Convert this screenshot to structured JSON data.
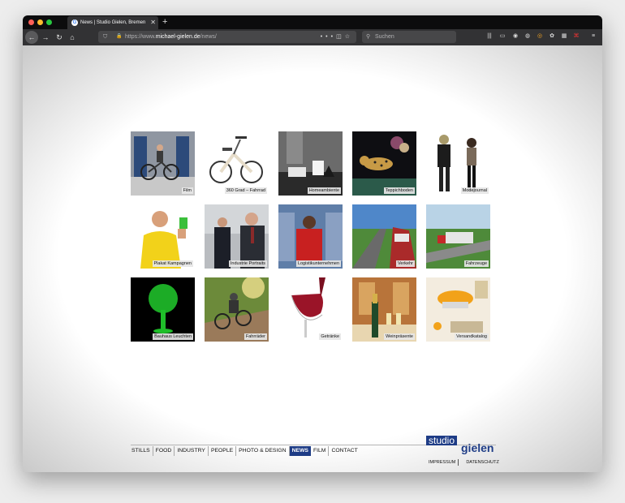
{
  "browser": {
    "tab_title": "News | Studio Gielen, Bremen",
    "tab_favicon": "G",
    "url_prefix": "https://www.",
    "url_domain": "michael-gielen.de",
    "url_path": "/news/",
    "search_placeholder": "Suchen"
  },
  "gallery": [
    {
      "label": "Film",
      "icon": "bicycle-rider"
    },
    {
      "label": "360 Grad – Fahrrad",
      "icon": "ebike"
    },
    {
      "label": "Homeambiente",
      "icon": "interior"
    },
    {
      "label": "Teppichboden",
      "icon": "leopard"
    },
    {
      "label": "Modejournal",
      "icon": "fashion-models"
    },
    {
      "label": "Plakat Kampagnen",
      "icon": "man-yellow-jacket"
    },
    {
      "label": "Industrie Portraits",
      "icon": "businessmen"
    },
    {
      "label": "Logistikunternehmen",
      "icon": "worker"
    },
    {
      "label": "Verkehr",
      "icon": "train"
    },
    {
      "label": "Fahrzeuge",
      "icon": "truck"
    },
    {
      "label": "Bauhaus Leuchten",
      "icon": "green-lamp"
    },
    {
      "label": "Fahrräder",
      "icon": "mountain-bike"
    },
    {
      "label": "Getränke",
      "icon": "wine-glass"
    },
    {
      "label": "Weinpräsente",
      "icon": "champagne"
    },
    {
      "label": "Versandkatalog",
      "icon": "caviar"
    }
  ],
  "footer": {
    "nav": [
      "STILLS",
      "FOOD",
      "INDUSTRY",
      "PEOPLE",
      "PHOTO & DESIGN",
      "NEWS",
      "FILM",
      "CONTACT"
    ],
    "active": "NEWS",
    "logo_top": "studio",
    "logo_bottom": "gielen",
    "impressum": "IMPRESSUM",
    "datenschutz": "DATENSCHUTZ"
  },
  "colors": {
    "brand": "#1e3c86",
    "chrome_dark": "#323234"
  }
}
